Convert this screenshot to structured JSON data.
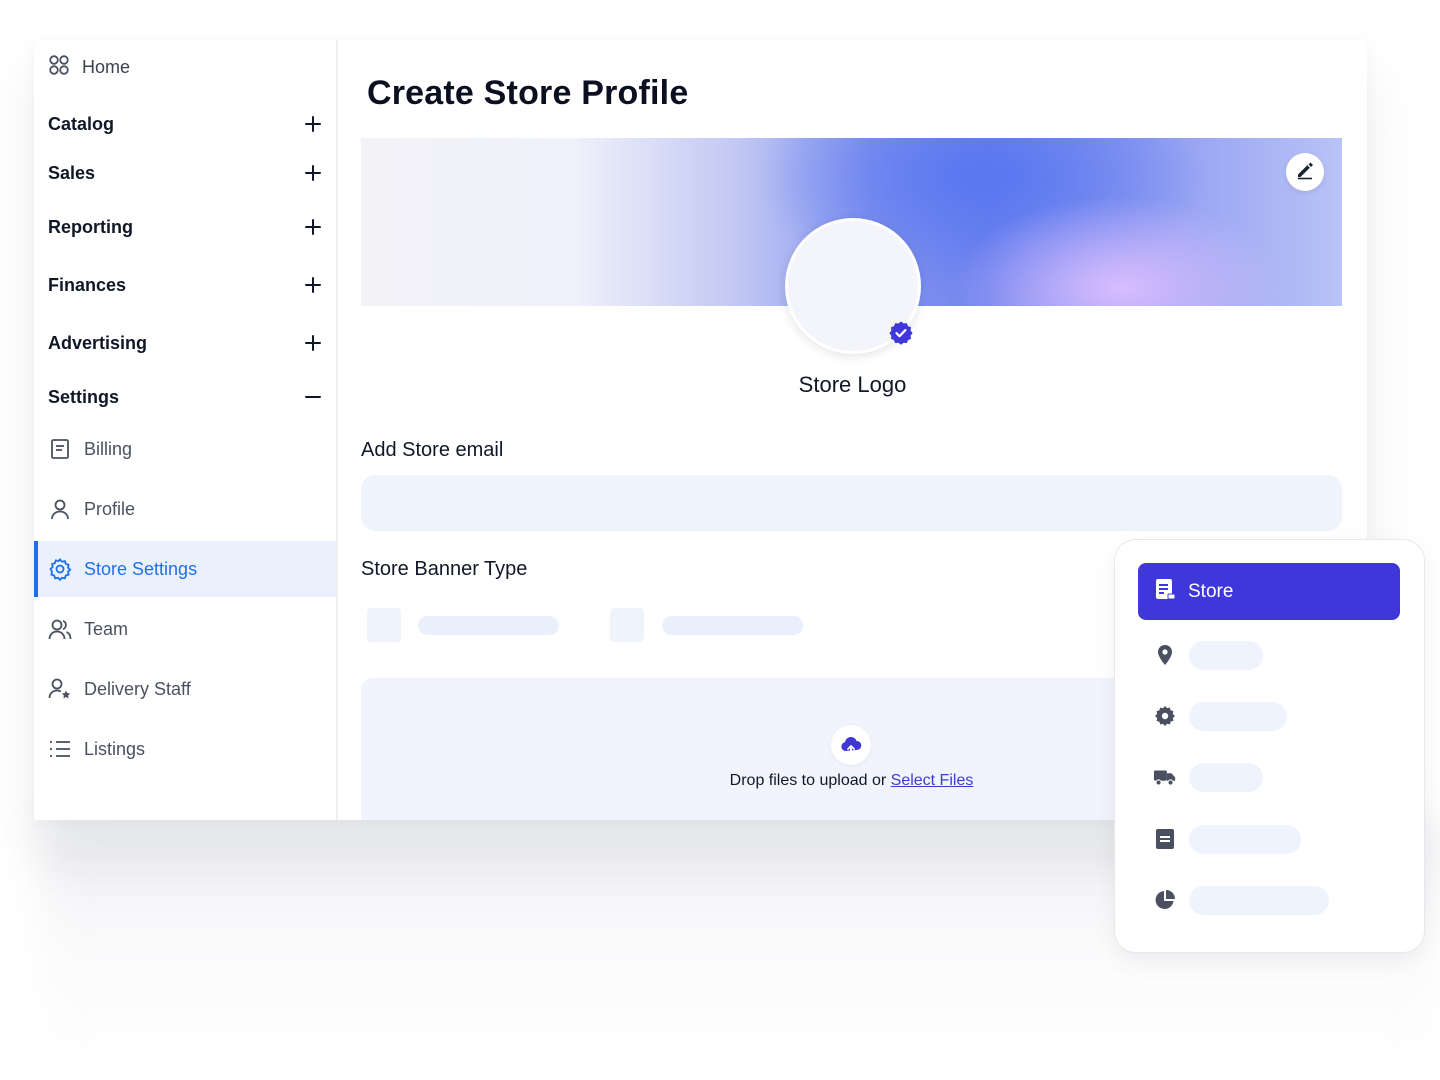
{
  "sidebar": {
    "home": {
      "label": "Home",
      "icon": "grid-icon"
    },
    "sections": [
      {
        "label": "Catalog",
        "state": "collapsed"
      },
      {
        "label": "Sales",
        "state": "collapsed"
      },
      {
        "label": "Reporting",
        "state": "collapsed"
      },
      {
        "label": "Finances",
        "state": "collapsed"
      },
      {
        "label": "Advertising",
        "state": "collapsed"
      },
      {
        "label": "Settings",
        "state": "expanded"
      }
    ],
    "settings_items": [
      {
        "label": "Billing",
        "icon": "document-icon"
      },
      {
        "label": "Profile",
        "icon": "user-icon"
      },
      {
        "label": "Store Settings",
        "icon": "gear-icon",
        "active": true
      },
      {
        "label": "Team",
        "icon": "users-icon"
      },
      {
        "label": "Delivery Staff",
        "icon": "user-star-icon"
      },
      {
        "label": "Listings",
        "icon": "list-icon"
      }
    ],
    "active_color": "#1f6feb"
  },
  "main": {
    "title": "Create Store Profile",
    "logo_label": "Store Logo",
    "email_label": "Add Store email",
    "email_value": "",
    "banner_type_label": "Store Banner Type",
    "dropzone": {
      "text": "Drop files to upload or",
      "link": "Select Files"
    }
  },
  "floating_panel": {
    "active": {
      "label": "Store",
      "icon": "store-document-icon",
      "color": "#3f37d9"
    },
    "items": [
      {
        "icon": "location-pin-icon"
      },
      {
        "icon": "gear-icon"
      },
      {
        "icon": "truck-icon"
      },
      {
        "icon": "document-icon"
      },
      {
        "icon": "pie-chart-icon"
      }
    ]
  }
}
